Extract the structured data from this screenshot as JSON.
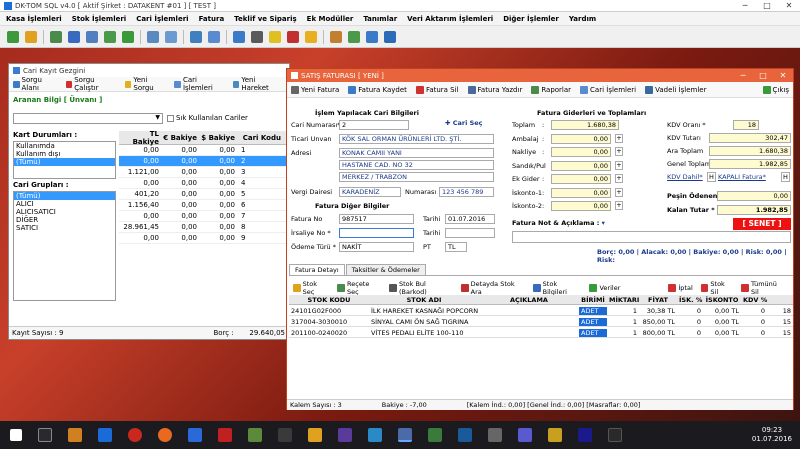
{
  "app": {
    "title": "DK-TOM SQL v4.0  [ Aktif Şirket : DATAKENT #01 ]  [ TEST ]",
    "menu": [
      "Kasa İşlemleri",
      "Stok İşlemleri",
      "Cari İşlemleri",
      "Fatura",
      "Teklif ve Sipariş",
      "Ek Modüller",
      "Tanımlar",
      "Veri Aktarım İşlemleri",
      "Diğer İşlemler",
      "Yardım"
    ]
  },
  "cari": {
    "title": "Cari Kayıt Gezgini",
    "tools": [
      "Sorgu Alanı",
      "Sorgu Çalıştır",
      "Yeni Sorgu",
      "Cari İşlemleri",
      "Yeni Hareket"
    ],
    "aranan_label": "Aranan Bilgi [ Ünvanı ]",
    "sik_label": "Sık Kullanılan Cariler",
    "kart_durum_label": "Kart Durumları :",
    "kart_durum": [
      "Kullanımda",
      "Kullanım dışı",
      "(Tümü)"
    ],
    "cari_grup_label": "Cari Grupları :",
    "cari_grup": [
      "(Tümü)",
      "ALICI",
      "ALICISATICI",
      "DİĞER",
      "SATICI"
    ],
    "columns": [
      "TL Bakiye",
      "€ Bakiye",
      "$ Bakiye",
      "Cari Kodu"
    ],
    "rows": [
      [
        "0,00",
        "0,00",
        "0,00",
        "1"
      ],
      [
        "0,00",
        "0,00",
        "0,00",
        "2"
      ],
      [
        "1.121,00",
        "0,00",
        "0,00",
        "3"
      ],
      [
        "0,00",
        "0,00",
        "0,00",
        "4"
      ],
      [
        "401,20",
        "0,00",
        "0,00",
        "5"
      ],
      [
        "1.156,40",
        "0,00",
        "0,00",
        "6"
      ],
      [
        "0,00",
        "0,00",
        "0,00",
        "7"
      ],
      [
        "28.961,45",
        "0,00",
        "0,00",
        "8"
      ],
      [
        "0,00",
        "0,00",
        "0,00",
        "9"
      ]
    ],
    "kayit_sayisi": "Kayıt Sayısı : 9",
    "borc_label": "Borç :",
    "borc_value": "29.640,05"
  },
  "satis": {
    "title": "SATIŞ FATURASI [ YENİ ]",
    "tools": [
      "Yeni Fatura",
      "Fatura Kaydet",
      "Fatura Sil",
      "Fatura Yazdır",
      "Raporlar",
      "Cari İşlemleri",
      "Vadeli İşlemler"
    ],
    "cikis": "Çıkış",
    "islem_hdr": "İşlem Yapılacak Cari Bilgileri",
    "cari_no_label": "Cari Numarası*",
    "cari_no": "2",
    "cari_sec": "Cari Seç",
    "unvan_label": "Ticari Unvan",
    "unvan": "KÖK SAL ORMAN ÜRÜNLERİ LTD. ŞTİ.",
    "adres_label": "Adresi",
    "adres": [
      "KONAK CAMII YANI",
      "HASTANE CAD. NO 32",
      "MERKEZ / TRABZON"
    ],
    "vd_label": "Vergi Dairesi",
    "vd": "KARADENİZ",
    "numarasi_label": "Numarası",
    "numarasi": "123 456 789",
    "diger_hdr": "Fatura Diğer Bilgiler",
    "fatura_no_label": "Fatura No",
    "fatura_no": "987517",
    "tarihi_label": "Tarihi",
    "tarih": "01.07.2016",
    "irsaliye_label": "İrsaliye No *",
    "odeme_label": "Ödeme Türü *",
    "odeme": "NAKİT",
    "pt_label": "PT",
    "pt": "TL",
    "gider_hdr": "Fatura Giderleri ve Toplamları",
    "left_items": [
      {
        "label": "Toplam",
        "value": "1.680,38"
      },
      {
        "label": "Ambalaj",
        "value": "0,00"
      },
      {
        "label": "Nakliye",
        "value": "0,00"
      },
      {
        "label": "Sandık/Pul",
        "value": "0,00"
      },
      {
        "label": "Ek Gider",
        "value": "0,00"
      },
      {
        "label": "İskonto-1",
        "value": "0,00"
      },
      {
        "label": "İskonto-2",
        "value": "0,00"
      }
    ],
    "kdv_orani_label": "KDV Oranı *",
    "kdv_orani": "18",
    "kdv_tutari_label": "KDV Tutarı",
    "kdv_tutari": "302,47",
    "ara_toplam_label": "Ara Toplam",
    "ara_toplam": "1.680,38",
    "genel_toplam_label": "Genel Toplam",
    "genel_toplam": "1.982,85",
    "kdv_dahil": "KDV Dahil*",
    "kapali_fatura": "KAPALI Fatura*",
    "h": "H",
    "pesin_label": "Peşin Ödenen",
    "pesin": "0,00",
    "kalan_label": "Kalan Tutar *",
    "kalan": "1.982,85",
    "senet": "[ SENET ]",
    "not_label": "Fatura Not & Açıklama :",
    "summary": "Borç: 0,00 | Alacak: 0,00 | Bakiye: 0,00 | Risk: 0,00 | Risk:",
    "tabs": [
      "Fatura Detayı",
      "Taksitler & Ödemeler"
    ],
    "detail_tools": [
      "Stok Seç",
      "Reçete Seç",
      "Stok Bul (Barkod)",
      "Detayda Stok Ara",
      "Stok Bilgileri",
      "Veriler",
      "İptal",
      "Stok Sil",
      "Tümünü Sil"
    ],
    "columns": [
      "STOK KODU",
      "STOK ADI",
      "AÇIKLAMA",
      "BİRİMİ",
      "MİKTARI",
      "FİYAT",
      "İSK. %",
      "İSKONTO",
      "KDV %"
    ],
    "rows": [
      [
        "24101G02F000",
        "İLK HAREKET KASNAĞI POPCORN",
        "",
        "ADET",
        "1",
        "30,38 TL",
        "0",
        "0,00 TL",
        "0",
        "18"
      ],
      [
        "317004-3030010",
        "SİNYAL CAMI ÖN SAĞ TIGRINA",
        "",
        "ADET",
        "1",
        "850,00 TL",
        "0",
        "0,00 TL",
        "0",
        "15"
      ],
      [
        "201100-0240020",
        "VİTES PEDALI ELİTE 100-110",
        "",
        "ADET",
        "1",
        "800,00 TL",
        "0",
        "0,00 TL",
        "0",
        "15"
      ]
    ],
    "kalem_sayisi": "Kalem Sayısı : 3",
    "bakiye": "Bakiye : -7,00",
    "status_rest": "[Kalem İnd.: 0,00] [Genel İnd.: 0,00] [Masraflar: 0,00]"
  },
  "taskbar": {
    "time": "09:23",
    "date": "01.07.2016",
    "lang": "TUR"
  },
  "colors": {
    "accent": "#e8643c",
    "selection": "#3399ff",
    "senet": "#ee1111"
  }
}
